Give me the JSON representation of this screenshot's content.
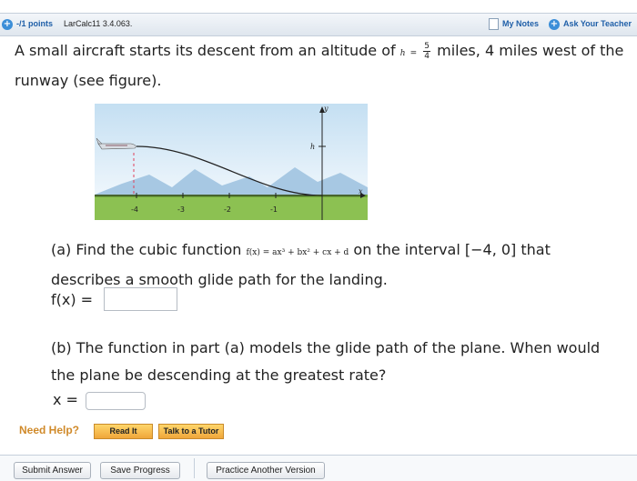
{
  "header": {
    "points": "-/1 points",
    "problem_id": "LarCalc11 3.4.063.",
    "my_notes": "My Notes",
    "ask_teacher": "Ask Your Teacher"
  },
  "intro": {
    "before": "A small aircraft starts its descent from an altitude of",
    "h_var": "h",
    "equals": "=",
    "frac_num": "5",
    "frac_den": "4",
    "after": "miles, 4 miles west of the runway (see figure)."
  },
  "figure": {
    "x_ticks": [
      "-4",
      "-3",
      "-2",
      "-1"
    ],
    "y_axis_label": "y",
    "x_axis_label": "x",
    "h_label": "h"
  },
  "part_a": {
    "text_before": "(a) Find the cubic function",
    "function_expr": "f(x) = ax³ + bx² + cx + d",
    "text_after": "on the interval [−4, 0] that describes a smooth glide path for the landing.",
    "answer_label": "f(x)  =",
    "answer_value": ""
  },
  "part_b": {
    "text": "(b) The function in part (a) models the glide path of the plane. When would the plane be descending at the greatest rate?",
    "answer_label": "x =",
    "answer_value": ""
  },
  "help": {
    "need_help": "Need Help?",
    "read_it": "Read It",
    "talk_tutor": "Talk to a Tutor"
  },
  "footer": {
    "submit": "Submit Answer",
    "save": "Save Progress",
    "practice": "Practice Another Version"
  },
  "colors": {
    "link_blue": "#1f5fa8",
    "help_orange": "#d08a2a",
    "sky": "#d6e9f6",
    "mountain": "#9ec3e0",
    "grass": "#8cc152"
  }
}
